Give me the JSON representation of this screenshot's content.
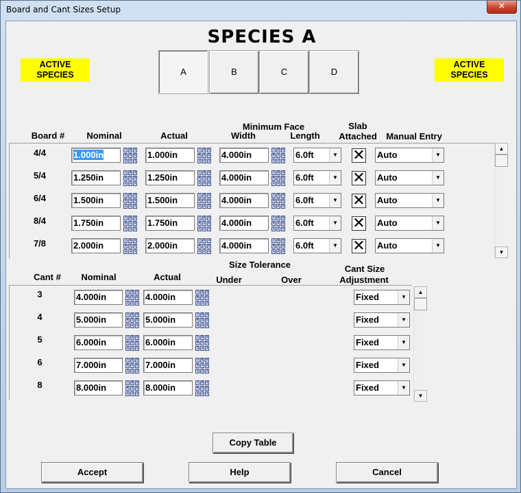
{
  "window": {
    "title": "Board and Cant Sizes Setup",
    "close_label": "✕"
  },
  "species_title": "SPECIES A",
  "active_badge_left": [
    "ACTIVE",
    "SPECIES"
  ],
  "active_badge_right": [
    "ACTIVE",
    "SPECIES"
  ],
  "tabs": [
    {
      "label": "A",
      "selected": true
    },
    {
      "label": "B",
      "selected": false
    },
    {
      "label": "C",
      "selected": false
    },
    {
      "label": "D",
      "selected": false
    }
  ],
  "boards": {
    "headers": {
      "board_num": "Board #",
      "nominal": "Nominal",
      "actual": "Actual",
      "min_face": "Minimum Face",
      "width": "Width",
      "length": "Length",
      "slab": "Slab",
      "attached": "Attached",
      "manual_entry": "Manual Entry"
    },
    "rows": [
      {
        "label": "4/4",
        "nominal": "1.000in",
        "actual": "1.000in",
        "width": "4.000in",
        "length": "6.0ft",
        "slab": "X",
        "manual": "Auto"
      },
      {
        "label": "5/4",
        "nominal": "1.250in",
        "actual": "1.250in",
        "width": "4.000in",
        "length": "6.0ft",
        "slab": "X",
        "manual": "Auto"
      },
      {
        "label": "6/4",
        "nominal": "1.500in",
        "actual": "1.500in",
        "width": "4.000in",
        "length": "6.0ft",
        "slab": "X",
        "manual": "Auto"
      },
      {
        "label": "8/4",
        "nominal": "1.750in",
        "actual": "1.750in",
        "width": "4.000in",
        "length": "6.0ft",
        "slab": "X",
        "manual": "Auto"
      },
      {
        "label": "7/8",
        "nominal": "2.000in",
        "actual": "2.000in",
        "width": "4.000in",
        "length": "6.0ft",
        "slab": "X",
        "manual": "Auto"
      }
    ]
  },
  "cants": {
    "headers": {
      "cant_num": "Cant #",
      "nominal": "Nominal",
      "actual": "Actual",
      "size_tolerance": "Size Tolerance",
      "under": "Under",
      "over": "Over",
      "cant_size": "Cant Size",
      "adjustment": "Adjustment"
    },
    "rows": [
      {
        "label": "3",
        "nominal": "4.000in",
        "actual": "4.000in",
        "adjustment": "Fixed"
      },
      {
        "label": "4",
        "nominal": "5.000in",
        "actual": "5.000in",
        "adjustment": "Fixed"
      },
      {
        "label": "5",
        "nominal": "6.000in",
        "actual": "6.000in",
        "adjustment": "Fixed"
      },
      {
        "label": "6",
        "nominal": "7.000in",
        "actual": "7.000in",
        "adjustment": "Fixed"
      },
      {
        "label": "8",
        "nominal": "8.000in",
        "actual": "8.000in",
        "adjustment": "Fixed"
      }
    ]
  },
  "keypad_digits": [
    "7",
    "8",
    "9",
    "4",
    "5",
    "6",
    "1",
    "2",
    "3"
  ],
  "buttons": {
    "copy_table": "Copy Table",
    "accept": "Accept",
    "help": "Help",
    "cancel": "Cancel"
  },
  "icons": {
    "dropdown": "▼",
    "scroll_up": "▲",
    "scroll_down": "▼"
  }
}
